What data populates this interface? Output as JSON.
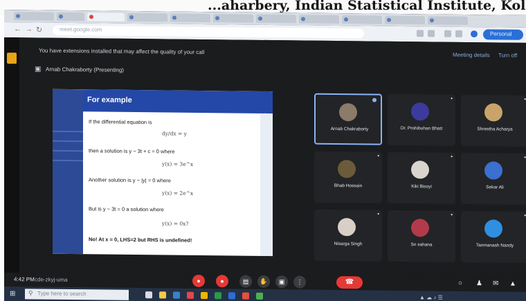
{
  "caption": {
    "text": "...aharbery, Indian Statistical Institute, Kolka"
  },
  "browser": {
    "url_text": "meet.google.com",
    "profile_label": "Personal"
  },
  "meet": {
    "warning": "You have extensions installed that may affect the quality of your call",
    "link_details": "Meeting details",
    "link_turn_off": "Turn off",
    "presenting": "Arnab Chakraborty (Presenting)"
  },
  "slide": {
    "title": "For example",
    "line1": "If the differential equation is",
    "eq1": "dy/dx = y",
    "line2": "then a solution is y − 3t + c = 0 where",
    "eq2": "y(x) = 3e^x",
    "line3": "Another solution is y − |y| = 0 where",
    "eq3": "y(x) = 2e^x",
    "line4": "But is y − 3t = 0 a solution where",
    "eq4": "y(x) = 0x?",
    "line5": "No! At x = 0, LHS=2 but RHS is undefined!"
  },
  "participants": [
    {
      "name": "Arnab Chakraborty",
      "color": "#8b7b68",
      "active": true
    },
    {
      "name": "Dr. Prohibuhan Bhatt",
      "color": "#3d3a9e",
      "active": false
    },
    {
      "name": "Shrestha Acharya",
      "color": "#c8a46a",
      "active": false
    },
    {
      "name": "Bhab Hossain",
      "color": "#6c5b3a",
      "active": false
    },
    {
      "name": "Kiki Bisoyi",
      "color": "#d9d4cd",
      "active": false
    },
    {
      "name": "Sekar Ali",
      "color": "#3b6fd0",
      "active": false
    },
    {
      "name": "Nisarga Singh",
      "color": "#d8cfc6",
      "active": false
    },
    {
      "name": "Sn sahana",
      "color": "#b23a4a",
      "active": false
    },
    {
      "name": "Tanmanash Nandy",
      "color": "#2f8fe0",
      "active": false
    }
  ],
  "controls": {
    "clock": "4:42 PM",
    "code": "cde-zkyj-uma"
  },
  "taskbar": {
    "search_placeholder": "Type here to search"
  }
}
